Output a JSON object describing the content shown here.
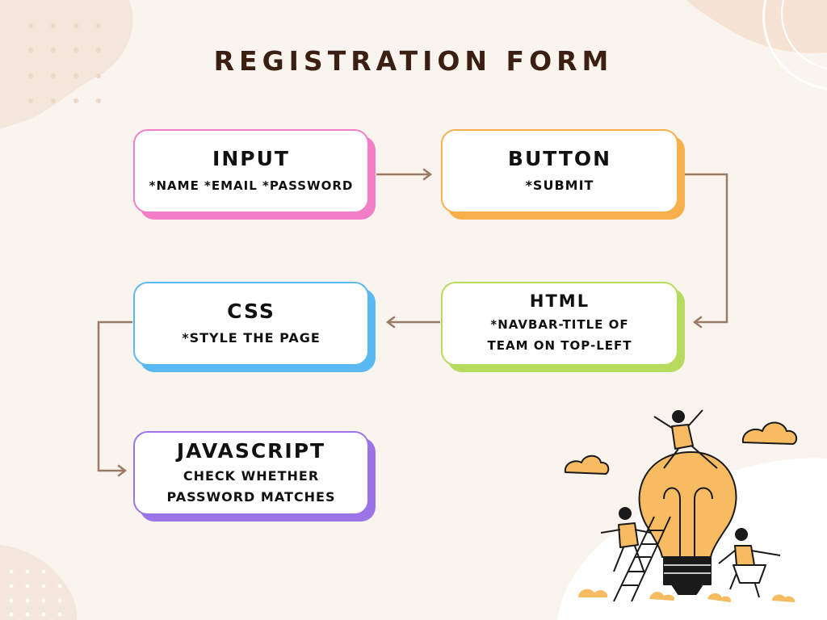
{
  "title": "REGISTRATION FORM",
  "colors": {
    "background": "#faf4ee",
    "title": "#3b1f12",
    "connector": "#9a7b66",
    "input": "#f37ec8",
    "button": "#f8b04c",
    "css": "#5ab8f2",
    "html": "#b6db5e",
    "javascript": "#9d74e8",
    "illustration": "#f7bb62"
  },
  "nodes": {
    "input": {
      "heading": "INPUT",
      "body": "*NAME  *EMAIL *PASSWORD"
    },
    "button": {
      "heading": "BUTTON",
      "body": "*SUBMIT"
    },
    "html": {
      "heading": "HTML",
      "body": "*NAVBAR-TITLE OF\nTEAM ON TOP-LEFT"
    },
    "css": {
      "heading": "CSS",
      "body": "*STYLE THE PAGE"
    },
    "javascript": {
      "heading": "JAVASCRIPT",
      "body": "CHECK WHETHER\nPASSWORD MATCHES"
    }
  },
  "flow": [
    "input",
    "button",
    "html",
    "css",
    "javascript"
  ],
  "illustration": {
    "subject": "lightbulb-with-people-icon"
  }
}
